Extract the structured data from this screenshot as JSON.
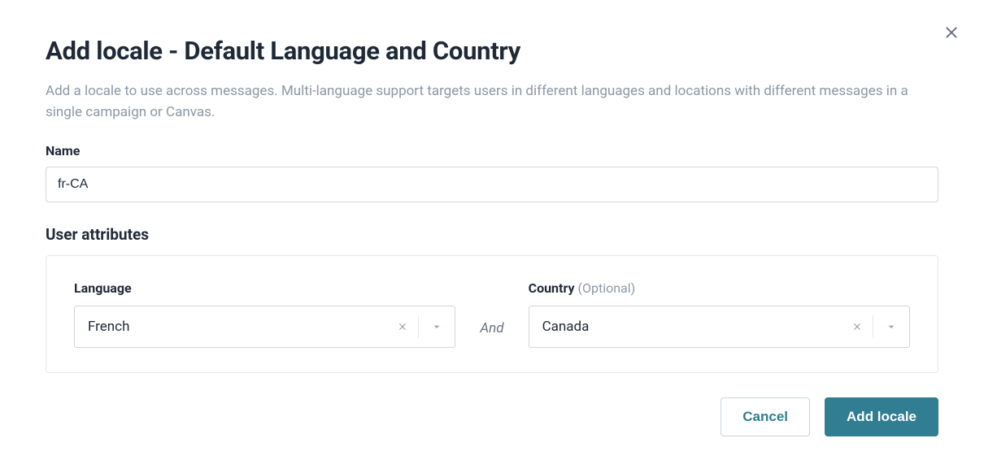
{
  "modal": {
    "title": "Add locale - Default Language and Country",
    "description": "Add a locale to use across messages. Multi-language support targets users in different languages and locations with different messages in a single campaign or Canvas."
  },
  "nameField": {
    "label": "Name",
    "value": "fr-CA"
  },
  "userAttributes": {
    "sectionTitle": "User attributes",
    "language": {
      "label": "Language",
      "value": "French"
    },
    "connector": "And",
    "country": {
      "label": "Country",
      "optional": "(Optional)",
      "value": "Canada"
    }
  },
  "footer": {
    "cancel": "Cancel",
    "submit": "Add locale"
  }
}
